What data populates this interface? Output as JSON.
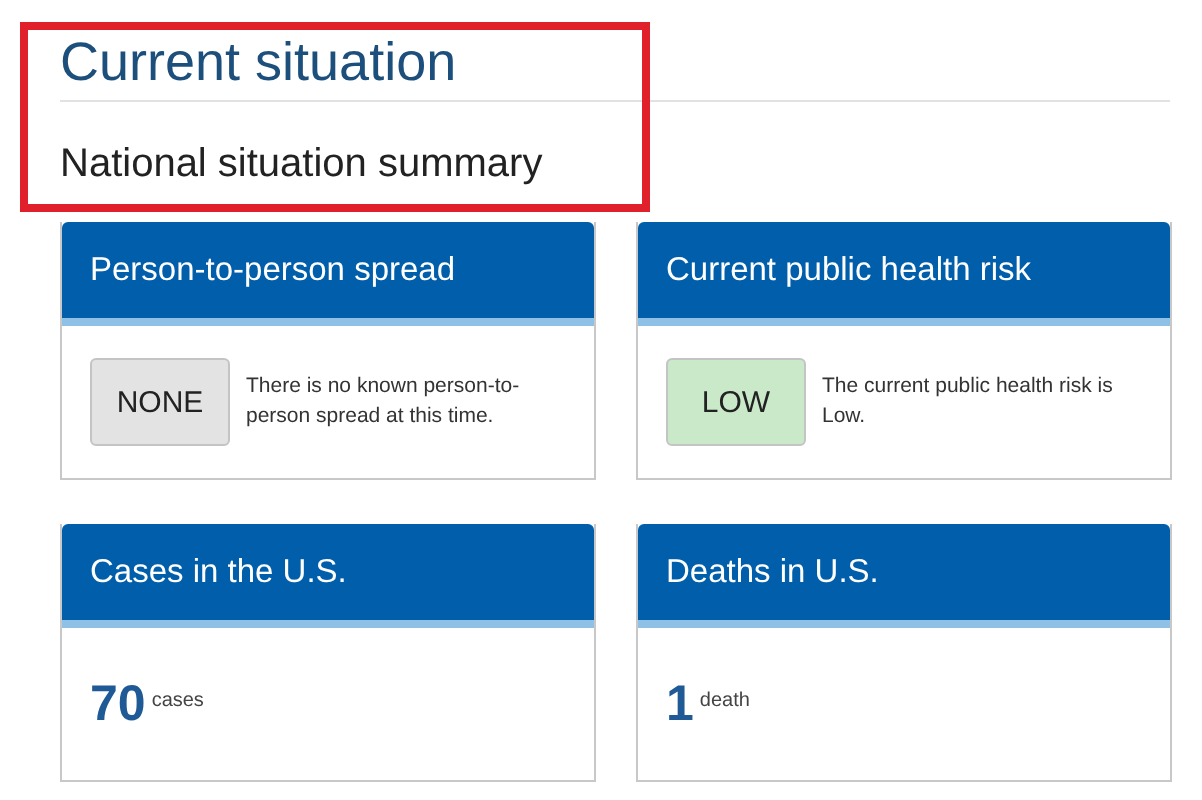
{
  "heading": "Current situation",
  "subheading": "National situation summary",
  "cards": [
    {
      "kind": "rating",
      "title": "Person-to-person spread",
      "badge": "NONE",
      "color": "#e3e3e3",
      "text": "There is no known person-to-person spread at this time."
    },
    {
      "kind": "rating",
      "title": "Current public health risk",
      "badge": "LOW",
      "color": "#c9e9c9",
      "text": "The current public health risk is Low."
    },
    {
      "kind": "count",
      "title": "Cases in the U.S.",
      "number": "70",
      "unit": "cases"
    },
    {
      "kind": "count",
      "title": "Deaths in U.S.",
      "number": "1",
      "unit": "death"
    }
  ]
}
